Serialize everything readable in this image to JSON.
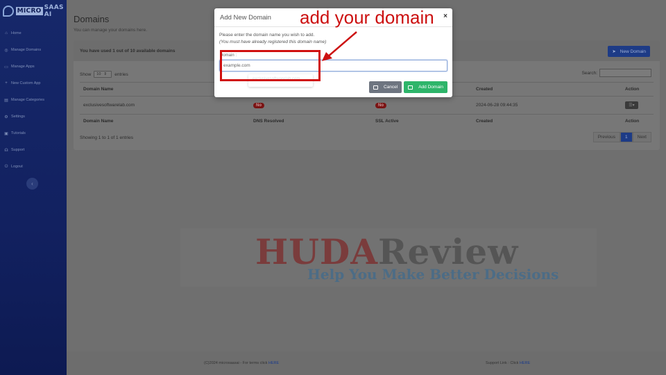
{
  "brand": {
    "logo_word1": "MICRO",
    "logo_word2": "SAAS AI"
  },
  "sidebar": {
    "items": [
      {
        "label": "Home",
        "icon": "home-icon"
      },
      {
        "label": "Manage Domains",
        "icon": "globe-icon"
      },
      {
        "label": "Manage Apps",
        "icon": "window-icon"
      },
      {
        "label": "New Custom App",
        "icon": "plus-icon"
      },
      {
        "label": "Manage Categories",
        "icon": "folder-icon"
      },
      {
        "label": "Settings",
        "icon": "gear-icon"
      },
      {
        "label": "Tutorials",
        "icon": "book-icon"
      },
      {
        "label": "Support",
        "icon": "headset-icon"
      },
      {
        "label": "Logout",
        "icon": "logout-icon"
      }
    ],
    "collapse_glyph": "‹"
  },
  "page": {
    "title": "Domains",
    "subtitle": "You can manage your domains here.",
    "usage": "You have used 1 out of 10 available domains",
    "new_domain_label": "New Domain",
    "show_label": "Show",
    "show_value": "10",
    "entries_label": "entries",
    "search_label": "Search:",
    "columns": [
      "Domain Name",
      "DNS Resolved",
      "SSL Active",
      "Created",
      "Action"
    ],
    "rows": [
      {
        "domain": "exclusivesoftwarelab.com",
        "dns": "No",
        "ssl": "No",
        "created": "2024-06-28 09:44:35"
      }
    ],
    "showing": "Showing 1 to 1 of 1 entries",
    "pager": {
      "previous": "Previous",
      "page": "1",
      "next": "Next"
    }
  },
  "footer": {
    "left_text": "(C)2024 microsaasai - For terms click",
    "left_link": "HERE",
    "right_text": "Support Link : Click",
    "right_link": "HERE"
  },
  "modal": {
    "title": "Add New Domain",
    "close": "×",
    "instruction": "Please enter the domain name you wish to add.",
    "note": "(You must have already registered this domain name)",
    "field_label": "Domain :",
    "field_placeholder": "example.com",
    "autocomplete": "exclusivesoftwarelab.com",
    "cancel_label": "Cancel",
    "add_label": "Add Domain"
  },
  "annotation": {
    "text": "add your domain",
    "color": "#cc1010"
  },
  "watermark": {
    "word1": "HUDA",
    "word2": "Review",
    "tagline": "Help You Make Better Decisions"
  },
  "colors": {
    "primary": "#1d3b86",
    "success": "#2eb56a",
    "danger": "#7a1414",
    "sidebar": "#16286a"
  }
}
